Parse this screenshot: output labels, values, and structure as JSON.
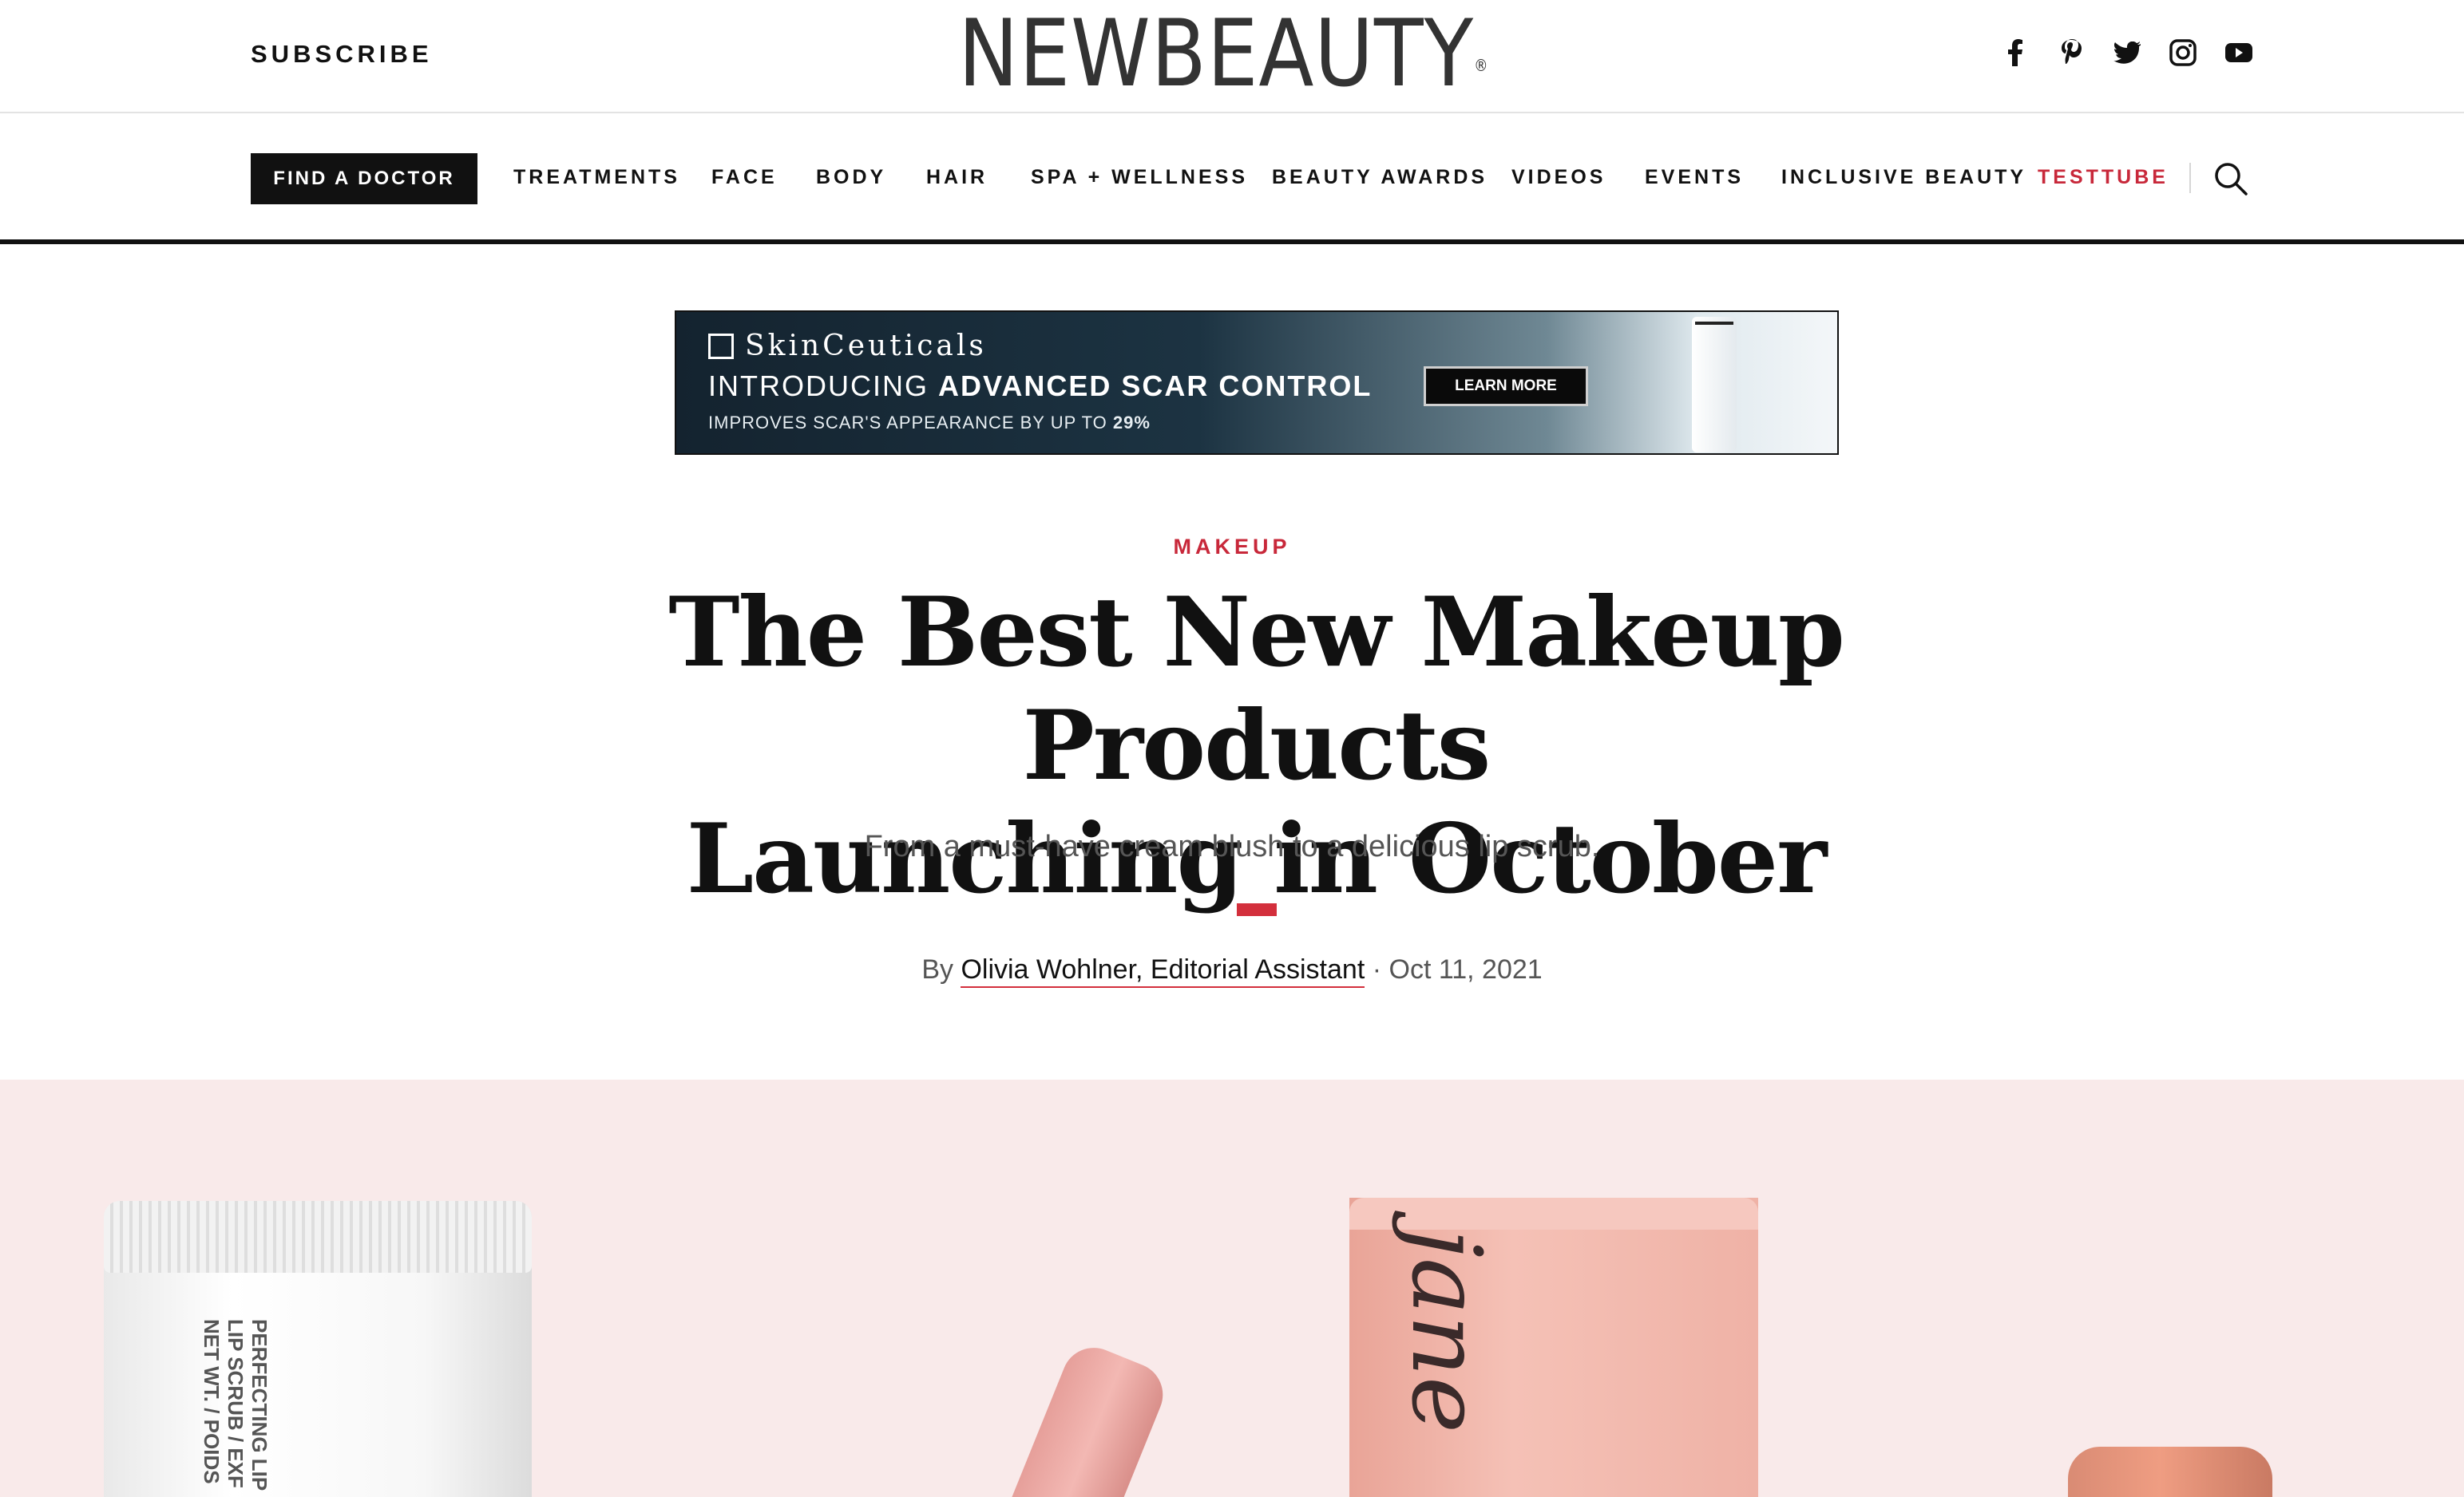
{
  "header": {
    "subscribe_label": "SUBSCRIBE",
    "logo_text": "NEWBEAUTY",
    "logo_mark": "®",
    "social_icons": [
      "facebook-icon",
      "pinterest-icon",
      "twitter-icon",
      "instagram-icon",
      "youtube-icon"
    ]
  },
  "nav": {
    "find_doctor": "FIND A DOCTOR",
    "items": [
      {
        "label": "TREATMENTS"
      },
      {
        "label": "FACE"
      },
      {
        "label": "BODY"
      },
      {
        "label": "HAIR"
      },
      {
        "label": "SPA + WELLNESS"
      },
      {
        "label": "BEAUTY AWARDS"
      },
      {
        "label": "VIDEOS"
      },
      {
        "label": "EVENTS"
      },
      {
        "label": "INCLUSIVE BEAUTY"
      },
      {
        "label": "TESTTUBE"
      }
    ],
    "search_icon": "search-icon"
  },
  "ad": {
    "brand": "SkinCeuticals",
    "line_prefix": "INTRODUCING ",
    "line_bold": "ADVANCED SCAR CONTROL",
    "sub_prefix": "IMPROVES SCAR'S APPEARANCE BY UP TO ",
    "sub_bold": "29%",
    "cta": "LEARN MORE"
  },
  "article": {
    "category": "MAKEUP",
    "title_line1": "The Best New Makeup Products",
    "title_line2": "Launching in October",
    "dek": "From a must-have cream blush to a delicious lip scrub.",
    "by": "By",
    "author": "Olivia Wohlner, Editorial Assistant",
    "date": "· Oct 11, 2021"
  },
  "hero": {
    "tube_text_1": "PERFECTING LIP",
    "tube_text_2": "LIP SCRUB / EXF",
    "tube_text_3": "NET WT. / POIDS",
    "box_script": "jane"
  },
  "colors": {
    "accent_red": "#c8283a",
    "hero_bg": "#f9eaea",
    "nav_black": "#111111"
  }
}
